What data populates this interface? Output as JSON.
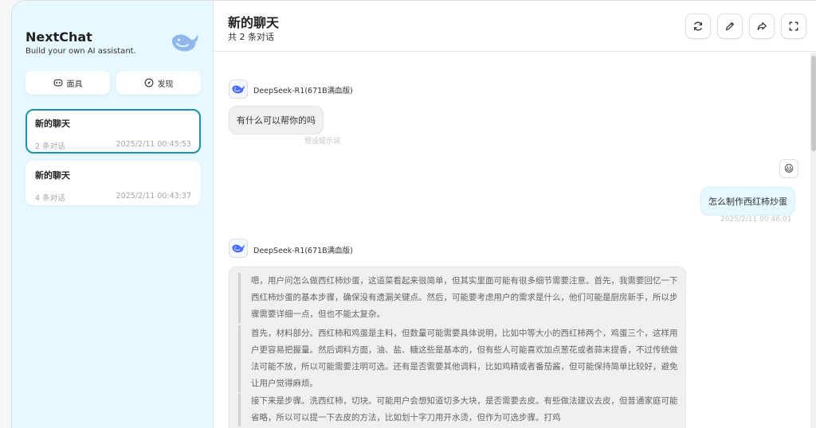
{
  "sidebar": {
    "app_title": "NextChat",
    "app_subtitle": "Build your own AI assistant.",
    "mask_label": "面具",
    "discover_label": "发现",
    "chats": [
      {
        "title": "新的聊天",
        "count": "2 条对话",
        "time": "2025/2/11 00:45:53"
      },
      {
        "title": "新的聊天",
        "count": "4 条对话",
        "time": "2025/2/11 00:43:37"
      }
    ]
  },
  "header": {
    "title": "新的聊天",
    "subtitle": "共 2 条对话"
  },
  "messages": {
    "bot1_model": "DeepSeek-R1(671B满血版)",
    "bot1_text": "有什么可以帮你的吗",
    "bot1_note": "预设提示词",
    "user_text": "怎么制作西红柿炒蛋",
    "user_time": "2025/2/11 00:46:01",
    "bot2_model": "DeepSeek-R1(671B满血版)",
    "think_paragraphs": [
      "嗯，用户问怎么做西红柿炒蛋，这道菜看起来很简单，但其实里面可能有很多细节需要注意。首先，我需要回忆一下西红柿炒蛋的基本步骤，确保没有遗漏关键点。然后，可能要考虑用户的需求是什么，他们可能是厨房新手，所以步骤需要详细一点，但也不能太复杂。",
      "首先，材料部分。西红柿和鸡蛋是主料，但数量可能需要具体说明，比如中等大小的西红柿两个，鸡蛋三个，这样用户更容易把握量。然后调料方面，油、盐、糖这些是基本的，但有些人可能喜欢加点葱花或者蒜末提香，不过传统做法可能不放，所以可能需要注明可选。还有是否需要其他调料，比如鸡精或者番茄酱，但可能保持简单比较好，避免让用户觉得麻烦。",
      "接下来是步骤。洗西红柿，切块。可能用户会想知道切多大块，是否需要去皮。有些做法建议去皮，但普通家庭可能省略，所以可以提一下去皮的方法，比如划十字刀用开水烫，但作为可选步骤。打鸡"
    ]
  },
  "colors": {
    "sidebar_bg": "#e7f8ff",
    "accent": "#1d93ab",
    "user_bubble": "#e7f8ff",
    "bot_bubble": "#f0f0f0"
  },
  "icons": {
    "logo": "deepseek-whale-icon",
    "mask": "mask-icon",
    "discover": "compass-icon",
    "refresh": "refresh-icon",
    "edit": "edit-icon",
    "share": "share-icon",
    "fullscreen": "fullscreen-icon",
    "user_avatar": "smiley-emoji-icon"
  }
}
